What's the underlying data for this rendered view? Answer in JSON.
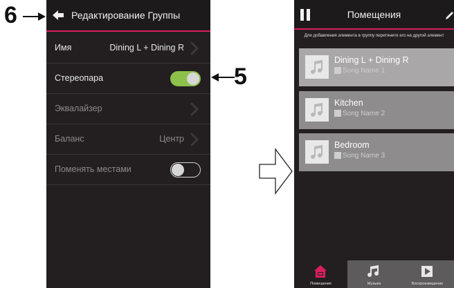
{
  "annotations": {
    "callout_6": "6",
    "callout_5": "5"
  },
  "left_screen": {
    "header": {
      "title": "Редактирование Группы"
    },
    "rows": [
      {
        "label": "Имя",
        "value": "Dining L + Dining R"
      },
      {
        "label": "Стереопара",
        "toggle": "on"
      },
      {
        "label": "Эквалайзер"
      },
      {
        "label": "Баланс",
        "value": "Центр"
      },
      {
        "label": "Поменять местами",
        "toggle": "off"
      }
    ]
  },
  "right_screen": {
    "header": {
      "title": "Помещения"
    },
    "hint": "Для добавления элемента в группу перетяните его на другой элемент",
    "rooms": [
      {
        "name": "Dining L + Dining R",
        "song": "Song Name 1"
      },
      {
        "name": "Kitchen",
        "song": "Song Name 2"
      },
      {
        "name": "Bedroom",
        "song": "Song Name 3"
      }
    ],
    "tabs": [
      {
        "label": "Помещения"
      },
      {
        "label": "Музыка"
      },
      {
        "label": "Воспроизведение"
      }
    ],
    "colors": {
      "accent": "#d81f5d",
      "toggle_on": "#8dc14b"
    }
  }
}
